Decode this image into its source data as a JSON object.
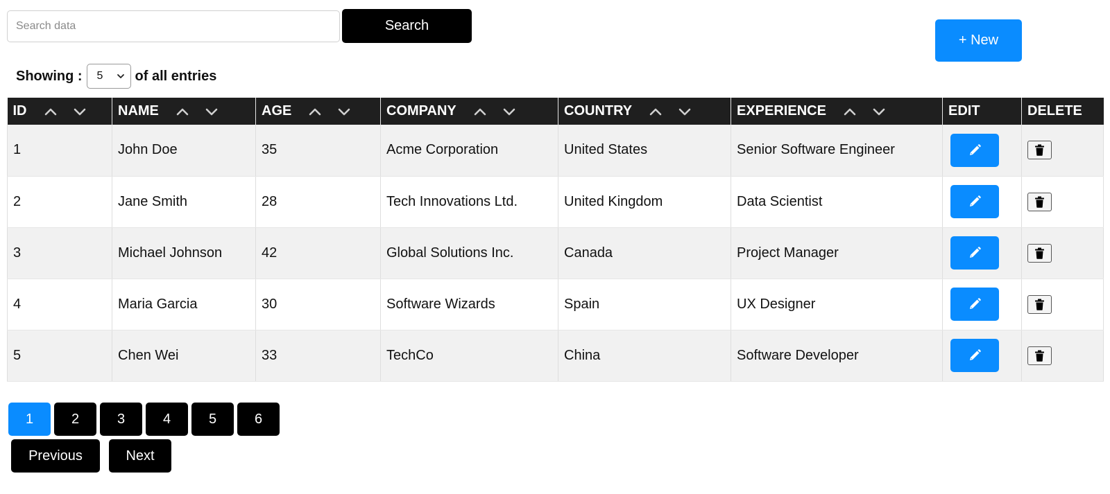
{
  "search": {
    "placeholder": "Search data",
    "value": "",
    "button_label": "Search"
  },
  "new_button_label": "+ New",
  "showing": {
    "prefix": "Showing :",
    "selected": "5",
    "suffix": "of all entries"
  },
  "table": {
    "columns": [
      {
        "key": "id",
        "label": "ID",
        "sortable": true
      },
      {
        "key": "name",
        "label": "NAME",
        "sortable": true
      },
      {
        "key": "age",
        "label": "AGE",
        "sortable": true
      },
      {
        "key": "company",
        "label": "COMPANY",
        "sortable": true
      },
      {
        "key": "country",
        "label": "COUNTRY",
        "sortable": true
      },
      {
        "key": "experience",
        "label": "EXPERIENCE",
        "sortable": true
      },
      {
        "key": "edit",
        "label": "EDIT",
        "sortable": false
      },
      {
        "key": "delete",
        "label": "DELETE",
        "sortable": false
      }
    ],
    "rows": [
      {
        "id": "1",
        "name": "John Doe",
        "age": "35",
        "company": "Acme Corporation",
        "country": "United States",
        "experience": "Senior Software Engineer"
      },
      {
        "id": "2",
        "name": "Jane Smith",
        "age": "28",
        "company": "Tech Innovations Ltd.",
        "country": "United Kingdom",
        "experience": "Data Scientist"
      },
      {
        "id": "3",
        "name": "Michael Johnson",
        "age": "42",
        "company": "Global Solutions Inc.",
        "country": "Canada",
        "experience": "Project Manager"
      },
      {
        "id": "4",
        "name": "Maria Garcia",
        "age": "30",
        "company": "Software Wizards",
        "country": "Spain",
        "experience": "UX Designer"
      },
      {
        "id": "5",
        "name": "Chen Wei",
        "age": "33",
        "company": "TechCo",
        "country": "China",
        "experience": "Software Developer"
      }
    ]
  },
  "pagination": {
    "pages": [
      "1",
      "2",
      "3",
      "4",
      "5",
      "6"
    ],
    "current": "1",
    "previous_label": "Previous",
    "next_label": "Next"
  },
  "colors": {
    "accent": "#0a8cff",
    "header_bg": "#1f1f1f",
    "button_dark": "#000000"
  },
  "icons": {
    "edit": "pencil-icon",
    "delete": "trash-icon",
    "sort_up": "chevron-up-icon",
    "sort_down": "chevron-down-icon"
  }
}
